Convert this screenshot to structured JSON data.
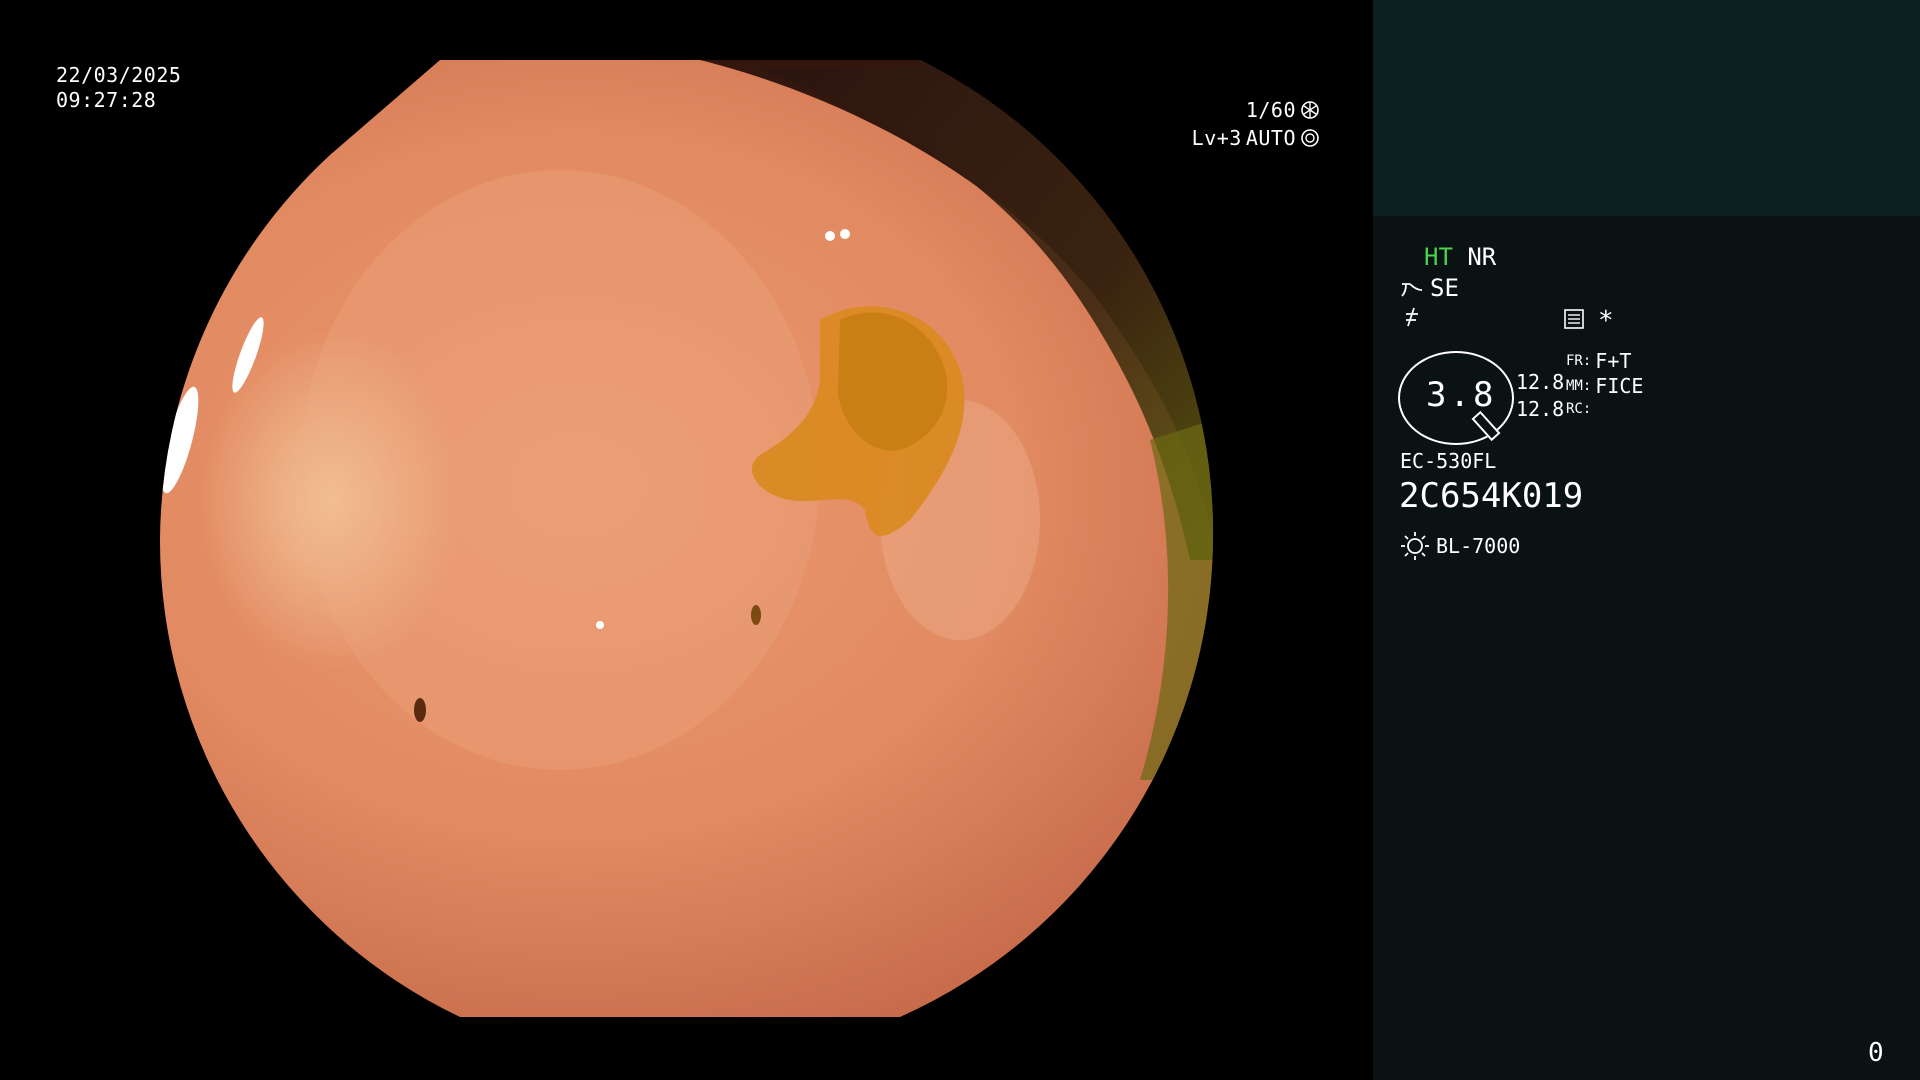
{
  "overlay": {
    "date": "22/03/2025",
    "time": "09:27:28",
    "shutter": "1/60",
    "shutter_icon": "shutter-icon",
    "level": "Lv+3",
    "mode": "AUTO",
    "mode_icon": "auto-iris-icon"
  },
  "panel": {
    "ht": "HT",
    "nr": "NR",
    "se": "SE",
    "se_icon": "structure-enhancement-icon",
    "color_icon": "color-tone-icon",
    "settings_icon": "settings-grid-icon",
    "asterisk": "*",
    "zoom": "3.8",
    "val_1": "12.8",
    "val_2": "12.8",
    "fr_label": "FR:",
    "fr_value": "F+T",
    "mm_label": "MM:",
    "mm_value": "FICE",
    "rc_label": "RC:",
    "rc_value": "",
    "scope_model": "EC-530FL",
    "scope_serial": "2C654K019",
    "light_icon": "light-source-icon",
    "light_source": "BL-7000",
    "counter": "0"
  },
  "colors": {
    "panel_bg": "#0a1213",
    "panel_top_bg": "#0c2022",
    "ht_green": "#4cd24c",
    "mucosa": "#e08a64"
  }
}
